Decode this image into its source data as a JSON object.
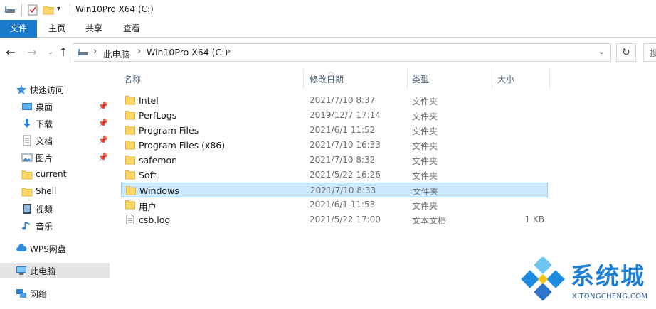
{
  "window": {
    "title": "Win10Pro X64 (C:)"
  },
  "ribbon": {
    "tabs": [
      "文件",
      "主页",
      "共享",
      "查看"
    ]
  },
  "address": {
    "crumbs": [
      "此电脑",
      "Win10Pro X64 (C:)"
    ],
    "search_placeholder": "搜"
  },
  "navpane": {
    "items": [
      {
        "label": "快速访问",
        "icon": "star-icon",
        "pinned": false
      },
      {
        "label": "桌面",
        "icon": "desktop-icon",
        "pinned": true
      },
      {
        "label": "下载",
        "icon": "download-icon",
        "pinned": true
      },
      {
        "label": "文档",
        "icon": "document-icon",
        "pinned": true
      },
      {
        "label": "图片",
        "icon": "pictures-icon",
        "pinned": true
      },
      {
        "label": "current",
        "icon": "folder-icon",
        "pinned": false
      },
      {
        "label": "Shell",
        "icon": "folder-icon",
        "pinned": false
      },
      {
        "label": "视频",
        "icon": "video-icon",
        "pinned": false
      },
      {
        "label": "音乐",
        "icon": "music-icon",
        "pinned": false
      },
      {
        "label": "WPS网盘",
        "icon": "cloud-icon",
        "pinned": false
      },
      {
        "label": "此电脑",
        "icon": "computer-icon",
        "pinned": false,
        "selected": true
      },
      {
        "label": "网络",
        "icon": "network-icon",
        "pinned": false
      }
    ]
  },
  "columns": {
    "name": "名称",
    "modified": "修改日期",
    "type": "类型",
    "size": "大小"
  },
  "files": [
    {
      "name": "Intel",
      "modified": "2021/7/10 8:37",
      "type": "文件夹",
      "size": "",
      "kind": "folder"
    },
    {
      "name": "PerfLogs",
      "modified": "2019/12/7 17:14",
      "type": "文件夹",
      "size": "",
      "kind": "folder"
    },
    {
      "name": "Program Files",
      "modified": "2021/6/1 11:52",
      "type": "文件夹",
      "size": "",
      "kind": "folder"
    },
    {
      "name": "Program Files (x86)",
      "modified": "2021/7/10 16:33",
      "type": "文件夹",
      "size": "",
      "kind": "folder"
    },
    {
      "name": "safemon",
      "modified": "2021/7/10 8:32",
      "type": "文件夹",
      "size": "",
      "kind": "folder"
    },
    {
      "name": "Soft",
      "modified": "2021/5/22 16:26",
      "type": "文件夹",
      "size": "",
      "kind": "folder"
    },
    {
      "name": "Windows",
      "modified": "2021/7/10 8:33",
      "type": "文件夹",
      "size": "",
      "kind": "folder",
      "selected": true
    },
    {
      "name": "用户",
      "modified": "2021/6/1 11:53",
      "type": "文件夹",
      "size": "",
      "kind": "folder"
    },
    {
      "name": "csb.log",
      "modified": "2021/5/22 17:00",
      "type": "文本文档",
      "size": "1 KB",
      "kind": "text"
    }
  ],
  "watermark": {
    "text": "系统城",
    "sub": "XITONGCHENG.COM"
  },
  "colors": {
    "accent": "#1979ca",
    "selection": "#cce8ff",
    "folder": "#ffd766"
  }
}
